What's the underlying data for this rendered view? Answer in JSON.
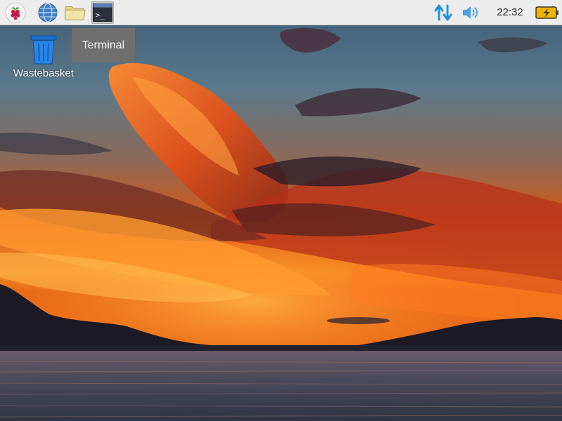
{
  "taskbar": {
    "launchers": [
      {
        "name": "Menu",
        "icon": "raspberry-pi-icon"
      },
      {
        "name": "Web Browser",
        "icon": "globe-icon"
      },
      {
        "name": "File Manager",
        "icon": "folder-icon"
      },
      {
        "name": "Terminal",
        "icon": "terminal-icon",
        "active": true
      }
    ],
    "tray": {
      "network_icon": "network-updown-arrows-icon",
      "volume_icon": "speaker-volume-icon",
      "clock": "22:32",
      "battery_icon": "battery-charging-icon"
    },
    "colors": {
      "panel_bg": "#ededed",
      "tray_accent": "#1e90e0",
      "battery_fill": "#f2b400"
    }
  },
  "tooltip": {
    "text": "Terminal"
  },
  "desktop": {
    "icons": [
      {
        "label": "Wastebasket",
        "icon": "trash-bin-icon"
      }
    ],
    "wallpaper": "sunset-clouds-over-lake"
  },
  "terminal_prompt_glyph": ">_"
}
